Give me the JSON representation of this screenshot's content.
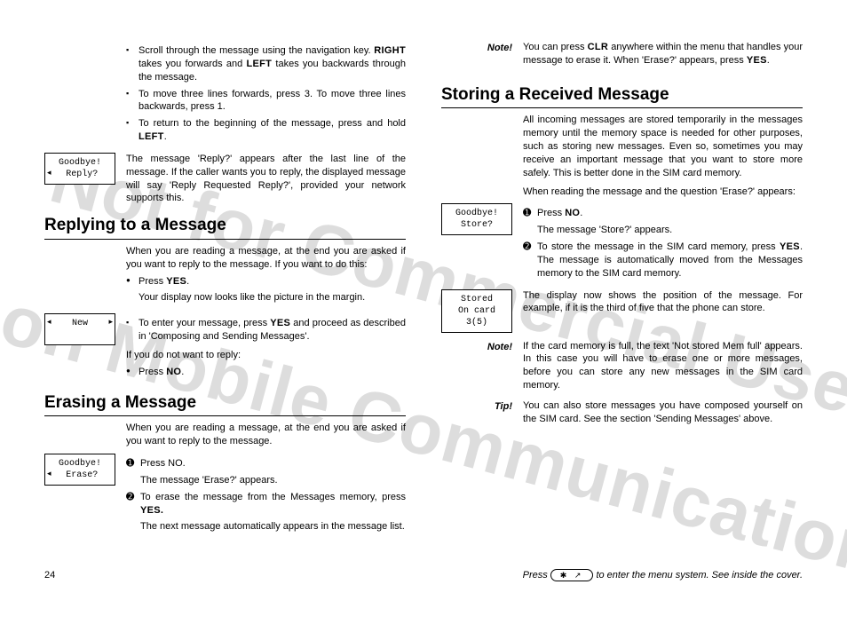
{
  "watermark": {
    "line1": "Not for Commercial Use",
    "line2": "Ericsson Mobile Communications AB"
  },
  "col1": {
    "bullets_top": [
      {
        "pre": "Scroll through the message using the navigation key. ",
        "b1": "RIGHT",
        "mid": " takes you forwards and ",
        "b2": "LEFT",
        "post": " takes you backwards through the message."
      },
      {
        "text": "To move three lines forwards, press 3. To move three lines backwards, press 1."
      },
      {
        "pre": "To return to the beginning of the message, press and hold ",
        "b1": "LEFT",
        "post": "."
      }
    ],
    "lcd1": {
      "l1": "Goodbye!",
      "l2": "Reply?"
    },
    "para_reply_box": "The message 'Reply?' appears after the last line of the message. If the caller wants you to reply, the displayed message will say 'Reply Requested Reply?', provided your network supports this.",
    "h_replying": "Replying to a Message",
    "reply_intro": "When you are reading a message, at the end you are asked if you want to reply to the message. If you want to do this:",
    "reply_b1_pre": "Press ",
    "reply_b1_b": "YES",
    "reply_b1_post": ".",
    "reply_after": "Your display now looks like the picture in the margin.",
    "lcd2": {
      "l1": "New"
    },
    "reply_b2_pre": "To enter your message, press ",
    "reply_b2_b": "YES",
    "reply_b2_post": " and proceed as described in 'Composing and Sending Messages'.",
    "reply_no_intro": "If you do not want to reply:",
    "reply_no_b_pre": "Press ",
    "reply_no_b_b": "NO",
    "reply_no_b_post": ".",
    "h_erasing": "Erasing a Message",
    "erase_intro": "When you are reading a message, at the end you are asked if you want to reply to the message.",
    "lcd3": {
      "l1": "Goodbye!",
      "l2": "Erase?"
    },
    "erase_s1": "Press NO.",
    "erase_s1_after": "The message 'Erase?' appears.",
    "erase_s2_pre": "To erase the message from the Messages memory, press ",
    "erase_s2_b": "YES.",
    "erase_after": "The next message automatically appears in the message list."
  },
  "col2": {
    "note1_label": "Note!",
    "note1_pre": "You can press ",
    "note1_b": "CLR",
    "note1_mid": " anywhere within the menu that handles your message to erase it. When 'Erase?' appears, press ",
    "note1_b2": "YES",
    "note1_post": ".",
    "h_storing": "Storing a Received Message",
    "store_intro": "All incoming messages are stored temporarily in the messages memory until the memory space is needed for other purposes, such as storing new messages. Even so, sometimes you may receive an important message that you want to store more safely. This is better done in the SIM card memory.",
    "store_q": "When reading the message and the question 'Erase?' appears:",
    "lcd4": {
      "l1": "Goodbye!",
      "l2": "Store?"
    },
    "s1_pre": "Press ",
    "s1_b": "NO",
    "s1_post": ".",
    "s1_after": "The message 'Store?' appears.",
    "s2_pre": "To store the message in the SIM card memory, press ",
    "s2_b": "YES",
    "s2_post": ". The message is automatically moved from the Messages memory to the SIM card memory.",
    "lcd5": {
      "l1": "Stored",
      "l2": "On card",
      "l3": "3(5)"
    },
    "pos_para": "The display now shows the position of the message. For example, if it is the third of five that the phone can store.",
    "note2_label": "Note!",
    "note2_text": "If the card memory is full, the text 'Not stored Mem full' appears. In this case you will have to erase one or more messages, before you can store any new messages in the SIM card memory.",
    "tip_label": "Tip!",
    "tip_text": "You can also store messages you have composed yourself on the SIM card. See the section 'Sending Messages' above."
  },
  "footer": {
    "page": "24",
    "hint_pre": "Press ",
    "hint_post": " to enter the menu system. See inside the cover.",
    "navkey": "✱ ↗"
  }
}
